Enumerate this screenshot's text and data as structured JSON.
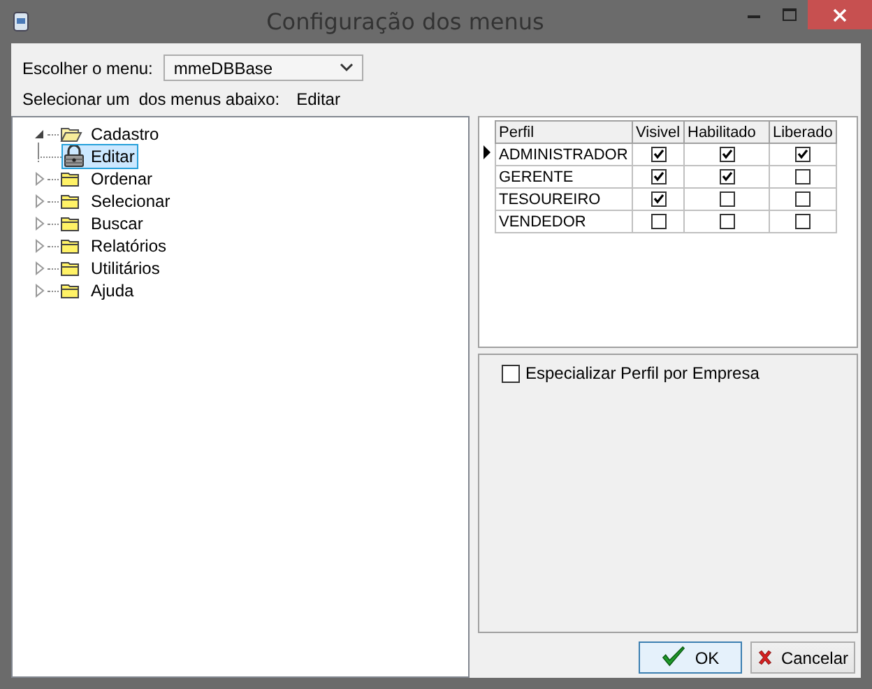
{
  "window": {
    "title": "Configuração dos menus"
  },
  "menu_picker": {
    "label": "Escolher o menu:",
    "value": "mmeDBBase"
  },
  "selection": {
    "label": "Selecionar um  dos menus abaixo:",
    "value": "Editar"
  },
  "tree": [
    {
      "label": "Cadastro",
      "expanded": true,
      "selected": false,
      "children": [
        {
          "label": "Editar",
          "kind": "lock",
          "selected": true
        }
      ]
    },
    {
      "label": "Ordenar",
      "expanded": false,
      "selected": false
    },
    {
      "label": "Selecionar",
      "expanded": false,
      "selected": false
    },
    {
      "label": "Buscar",
      "expanded": false,
      "selected": false
    },
    {
      "label": "Relatórios",
      "expanded": false,
      "selected": false
    },
    {
      "label": "Utilitários",
      "expanded": false,
      "selected": false
    },
    {
      "label": "Ajuda",
      "expanded": false,
      "selected": false
    }
  ],
  "grid": {
    "columns": [
      "Perfil",
      "Visivel",
      "Habilitado",
      "Liberado"
    ],
    "rows": [
      {
        "name": "ADMINISTRADOR",
        "selected": true,
        "visivel": true,
        "habilitado": true,
        "liberado": true
      },
      {
        "name": "GERENTE",
        "selected": false,
        "visivel": true,
        "habilitado": true,
        "liberado": false
      },
      {
        "name": "TESOUREIRO",
        "selected": false,
        "visivel": true,
        "habilitado": false,
        "liberado": false
      },
      {
        "name": "VENDEDOR",
        "selected": false,
        "visivel": false,
        "habilitado": false,
        "liberado": false
      }
    ]
  },
  "options": [
    {
      "label": "Especializar Perfil por Empresa",
      "checked": false
    }
  ],
  "buttons": [
    {
      "label": "OK",
      "kind": "ok"
    },
    {
      "label": "Cancelar",
      "kind": "cancel"
    }
  ]
}
